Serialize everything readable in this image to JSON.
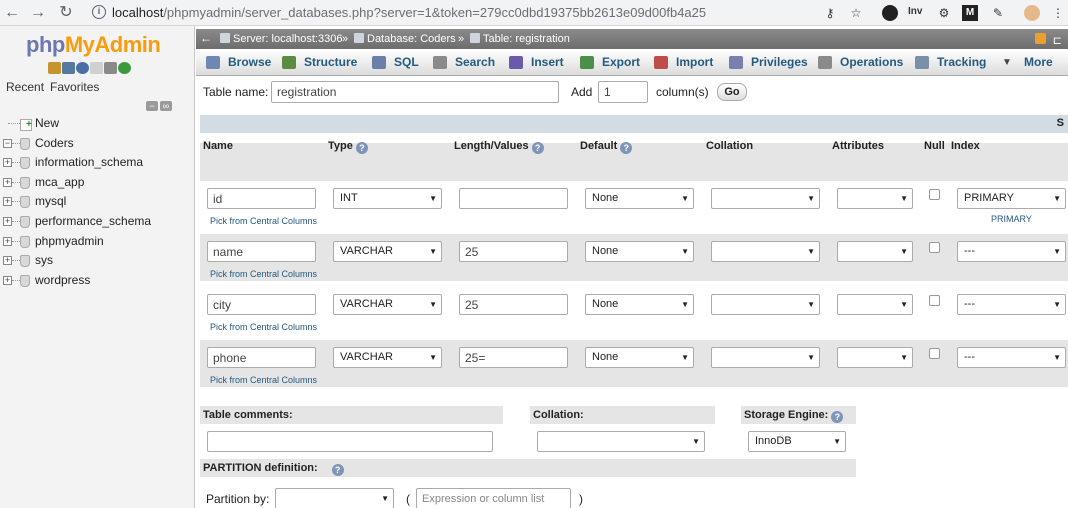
{
  "browser": {
    "back_icon": "←",
    "forward_icon": "→",
    "reload_icon": "↻",
    "url_host": "localhost",
    "url_path": "/phpmyadmin/server_databases.php?server=1&token=279cc0dbd19375bb2613e09d00fb4a25",
    "key_icon": "⚷",
    "star_icon": "☆",
    "inv_label": "Inv",
    "m_label": "M"
  },
  "sidebar": {
    "logo_php": "php",
    "logo_myadmin": "MyAdmin",
    "recent_tab": "Recent",
    "favorites_tab": "Favorites",
    "tree": [
      {
        "label": "New",
        "kind": "new"
      },
      {
        "label": "Coders",
        "kind": "db",
        "expander": "−"
      },
      {
        "label": "information_schema",
        "kind": "db",
        "expander": "+"
      },
      {
        "label": "mca_app",
        "kind": "db",
        "expander": "+"
      },
      {
        "label": "mysql",
        "kind": "db",
        "expander": "+"
      },
      {
        "label": "performance_schema",
        "kind": "db",
        "expander": "+"
      },
      {
        "label": "phpmyadmin",
        "kind": "db",
        "expander": "+"
      },
      {
        "label": "sys",
        "kind": "db",
        "expander": "+"
      },
      {
        "label": "wordpress",
        "kind": "db",
        "expander": "+"
      }
    ]
  },
  "breadcrumb": {
    "server": "Server: localhost:3306",
    "sep1": "»",
    "database": "Database: Coders",
    "sep2": "»",
    "table": "Table: registration"
  },
  "tabs": [
    {
      "label": "Browse",
      "icon": "browse-icon",
      "color": "#6f87b3"
    },
    {
      "label": "Structure",
      "icon": "structure-icon",
      "color": "#5c8c3f"
    },
    {
      "label": "SQL",
      "icon": "sql-icon",
      "color": "#6b7fa8"
    },
    {
      "label": "Search",
      "icon": "search-icon",
      "color": "#8a8a8a"
    },
    {
      "label": "Insert",
      "icon": "insert-icon",
      "color": "#6a5aa8"
    },
    {
      "label": "Export",
      "icon": "export-icon",
      "color": "#4b8f4b"
    },
    {
      "label": "Import",
      "icon": "import-icon",
      "color": "#c04b4b"
    },
    {
      "label": "Privileges",
      "icon": "privileges-icon",
      "color": "#7a7fb0"
    },
    {
      "label": "Operations",
      "icon": "operations-icon",
      "color": "#8a8a8a"
    },
    {
      "label": "Tracking",
      "icon": "tracking-icon",
      "color": "#7a8fa8"
    },
    {
      "label": "More",
      "icon": "chevron-down-icon",
      "color": "#444444"
    }
  ],
  "form": {
    "table_name_label": "Table name:",
    "table_name_value": "registration",
    "add_label": "Add",
    "add_value": "1",
    "columns_label": "column(s)",
    "go_label": "Go",
    "header_s": "S"
  },
  "columns_header": {
    "name": "Name",
    "type": "Type",
    "length": "Length/Values",
    "default": "Default",
    "collation": "Collation",
    "attributes": "Attributes",
    "null": "Null",
    "index": "Index"
  },
  "rows": [
    {
      "name": "id",
      "type": "INT",
      "length": "",
      "default": "None",
      "collation": "",
      "attributes": "",
      "index": "PRIMARY",
      "index_note": "PRIMARY",
      "pick": "Pick from Central Columns"
    },
    {
      "name": "name",
      "type": "VARCHAR",
      "length": "25",
      "default": "None",
      "collation": "",
      "attributes": "",
      "index": "---",
      "index_note": "",
      "pick": "Pick from Central Columns"
    },
    {
      "name": "city",
      "type": "VARCHAR",
      "length": "25",
      "default": "None",
      "collation": "",
      "attributes": "",
      "index": "---",
      "index_note": "",
      "pick": "Pick from Central Columns"
    },
    {
      "name": "phone",
      "type": "VARCHAR",
      "length": "25=",
      "default": "None",
      "collation": "",
      "attributes": "",
      "index": "---",
      "index_note": "",
      "pick": "Pick from Central Columns"
    }
  ],
  "footer": {
    "table_comments_label": "Table comments:",
    "collation_label": "Collation:",
    "storage_engine_label": "Storage Engine:",
    "storage_engine_value": "InnoDB",
    "partition_label": "PARTITION definition:",
    "partition_by_label": "Partition by:",
    "paren_open": "(",
    "paren_close": ")",
    "expression_placeholder": "Expression or column list"
  }
}
